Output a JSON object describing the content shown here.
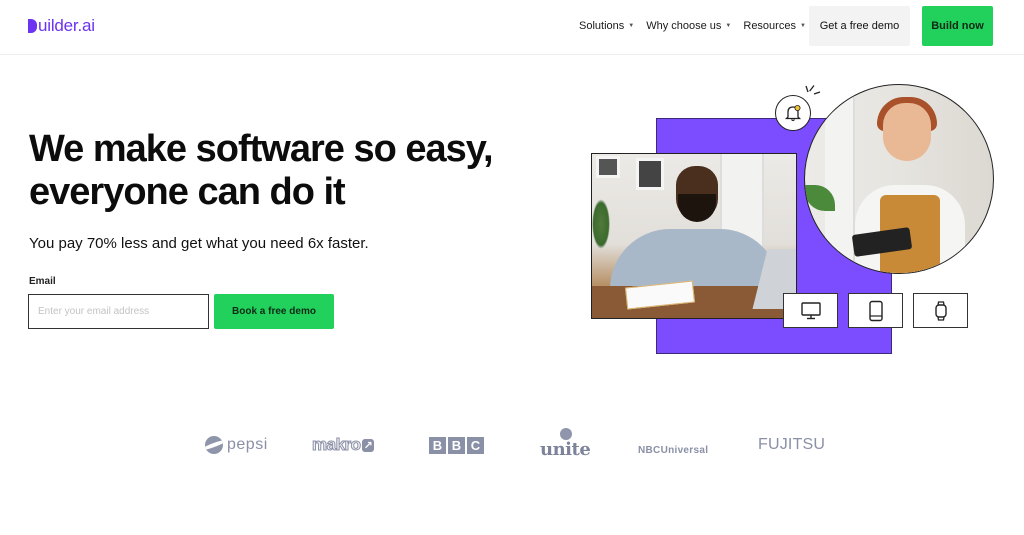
{
  "header": {
    "logo": "uilder.ai",
    "logo_full": "Builder.ai",
    "nav": [
      {
        "label": "Solutions",
        "icon": "caret-down-icon"
      },
      {
        "label": "Why choose us",
        "icon": "caret-down-icon"
      },
      {
        "label": "Resources",
        "icon": "caret-down-icon"
      }
    ],
    "demo_button": "Get a free demo",
    "build_button": "Build now"
  },
  "hero": {
    "title_line1": "We make software so easy,",
    "title_line2": "everyone can do it",
    "subtitle": "You pay 70% less and get what you need 6x faster.",
    "email_label": "Email",
    "email_value": "",
    "email_placeholder": "Enter your email address",
    "book_button": "Book a free demo"
  },
  "illustration": {
    "badge_icon": "bell-notification-icon",
    "devices": [
      "desktop-icon",
      "tablet-icon",
      "smartwatch-icon"
    ]
  },
  "colors": {
    "brand_purple": "#6c33f0",
    "accent_green": "#22d15c",
    "block_purple": "#7c4dff",
    "logo_gray": "#8a90a6"
  },
  "client_logos": [
    {
      "name": "pepsi",
      "text": "pepsi"
    },
    {
      "name": "makro",
      "text": "makro"
    },
    {
      "name": "bbc",
      "letters": [
        "B",
        "B",
        "C"
      ]
    },
    {
      "name": "unite",
      "text": "unite"
    },
    {
      "name": "nbcuniversal",
      "text": "NBCUniversal"
    },
    {
      "name": "fujitsu",
      "text": "FUJITSU"
    }
  ]
}
